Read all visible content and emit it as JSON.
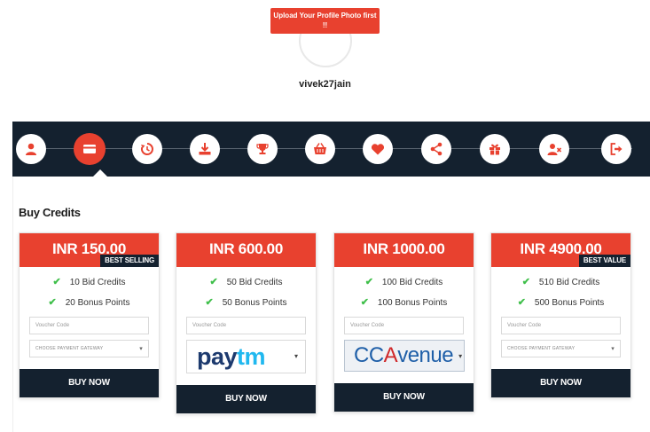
{
  "profile": {
    "upload_prompt": "Upload Your Profile Photo first !!",
    "username": "vivek27jain"
  },
  "nav": {
    "items": [
      {
        "icon": "user-icon"
      },
      {
        "icon": "credit-card-icon",
        "active": true
      },
      {
        "icon": "history-icon"
      },
      {
        "icon": "download-icon"
      },
      {
        "icon": "trophy-icon"
      },
      {
        "icon": "basket-icon"
      },
      {
        "icon": "heart-icon"
      },
      {
        "icon": "share-icon"
      },
      {
        "icon": "gift-icon"
      },
      {
        "icon": "remove-user-icon"
      },
      {
        "icon": "logout-icon"
      }
    ]
  },
  "section_title": "Buy Credits",
  "voucher_placeholder": "Voucher Code",
  "gateway_placeholder": "CHOOSE PAYMENT GATEWAY",
  "buy_label": "BUY NOW",
  "colors": {
    "accent": "#e8412f",
    "dark": "#14212f",
    "check": "#3fbf4a"
  },
  "plans": [
    {
      "price": "INR 150.00",
      "badge": "BEST SELLING",
      "bid_credits": "10 Bid Credits",
      "bonus_points": "20 Bonus Points",
      "gateway": "select"
    },
    {
      "price": "INR 600.00",
      "badge": "",
      "bid_credits": "50 Bid Credits",
      "bonus_points": "50 Bonus Points",
      "gateway": "paytm"
    },
    {
      "price": "INR 1000.00",
      "badge": "",
      "bid_credits": "100 Bid Credits",
      "bonus_points": "100 Bonus Points",
      "gateway": "ccavenue"
    },
    {
      "price": "INR 4900.00",
      "badge": "BEST VALUE",
      "bid_credits": "510 Bid Credits",
      "bonus_points": "500 Bonus Points",
      "gateway": "select"
    }
  ],
  "gateway_logos": {
    "paytm": [
      "pay",
      "tm"
    ],
    "ccavenue": [
      "CC",
      "A",
      "venue"
    ]
  }
}
